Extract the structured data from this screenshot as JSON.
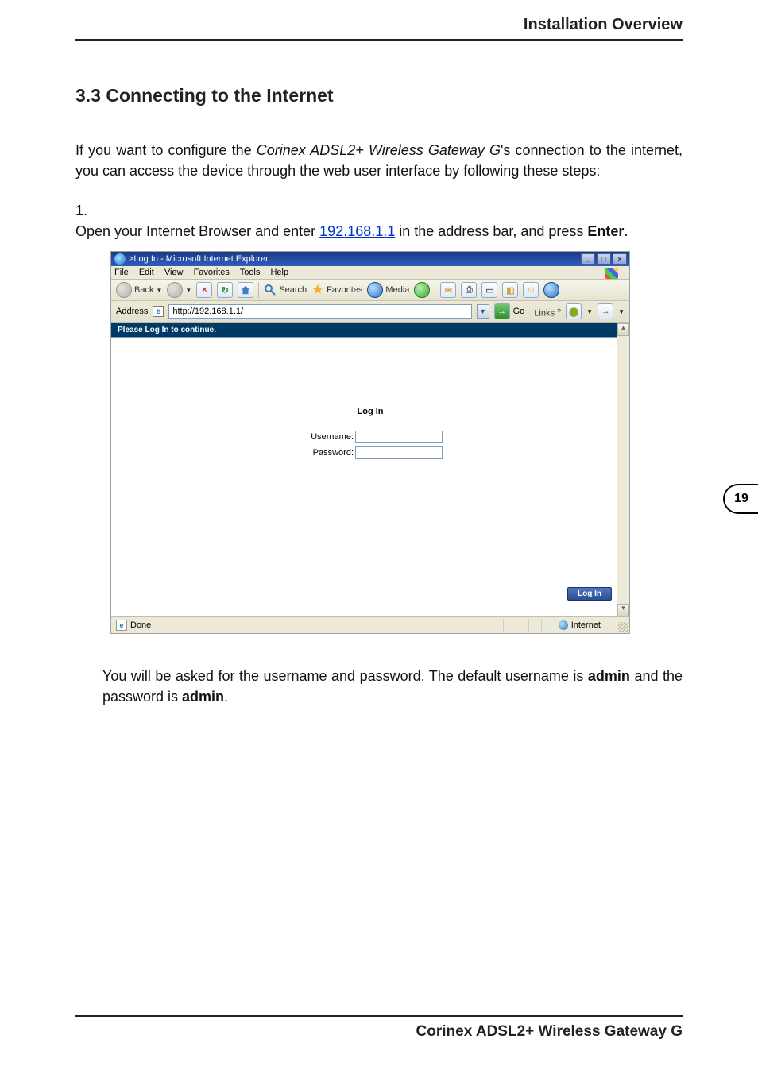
{
  "header": {
    "chapter_title": "Installation Overview"
  },
  "section": {
    "heading": "3.3 Connecting to the Internet"
  },
  "intro": {
    "pre": "If you want to configure the ",
    "product_italic": "Corinex ADSL2+ Wireless Gateway G",
    "post": "'s connection to the internet, you can access the device through the web user interface by following these steps:"
  },
  "step1": {
    "num": "1.",
    "pre": "Open your Internet Browser and enter ",
    "link_text": "192.168.1.1",
    "mid": " in the address bar, and press ",
    "bold": "Enter",
    "end": "."
  },
  "ie": {
    "title": ">Log In - Microsoft Internet Explorer",
    "menu": {
      "file": "File",
      "edit": "Edit",
      "view": "View",
      "fav": "Favorites",
      "tools": "Tools",
      "help": "Help"
    },
    "toolbar": {
      "back": "Back",
      "search": "Search",
      "favorites": "Favorites",
      "media": "Media"
    },
    "address": {
      "label": "Address",
      "value": "http://192.168.1.1/",
      "go": "Go",
      "links": "Links"
    },
    "banner": "Please Log In to continue.",
    "login": {
      "title": "Log In",
      "user_label": "Username:",
      "pass_label": "Password:",
      "button": "Log In"
    },
    "status": {
      "done": "Done",
      "zone": "Internet"
    }
  },
  "para2": {
    "pre": "You will be asked for the username and password. The default username is ",
    "b1": "admin",
    "mid": " and the password is ",
    "b2": "admin",
    "end": "."
  },
  "pagenum": "19",
  "footer": {
    "product": "Corinex ADSL2+ Wireless Gateway G"
  }
}
